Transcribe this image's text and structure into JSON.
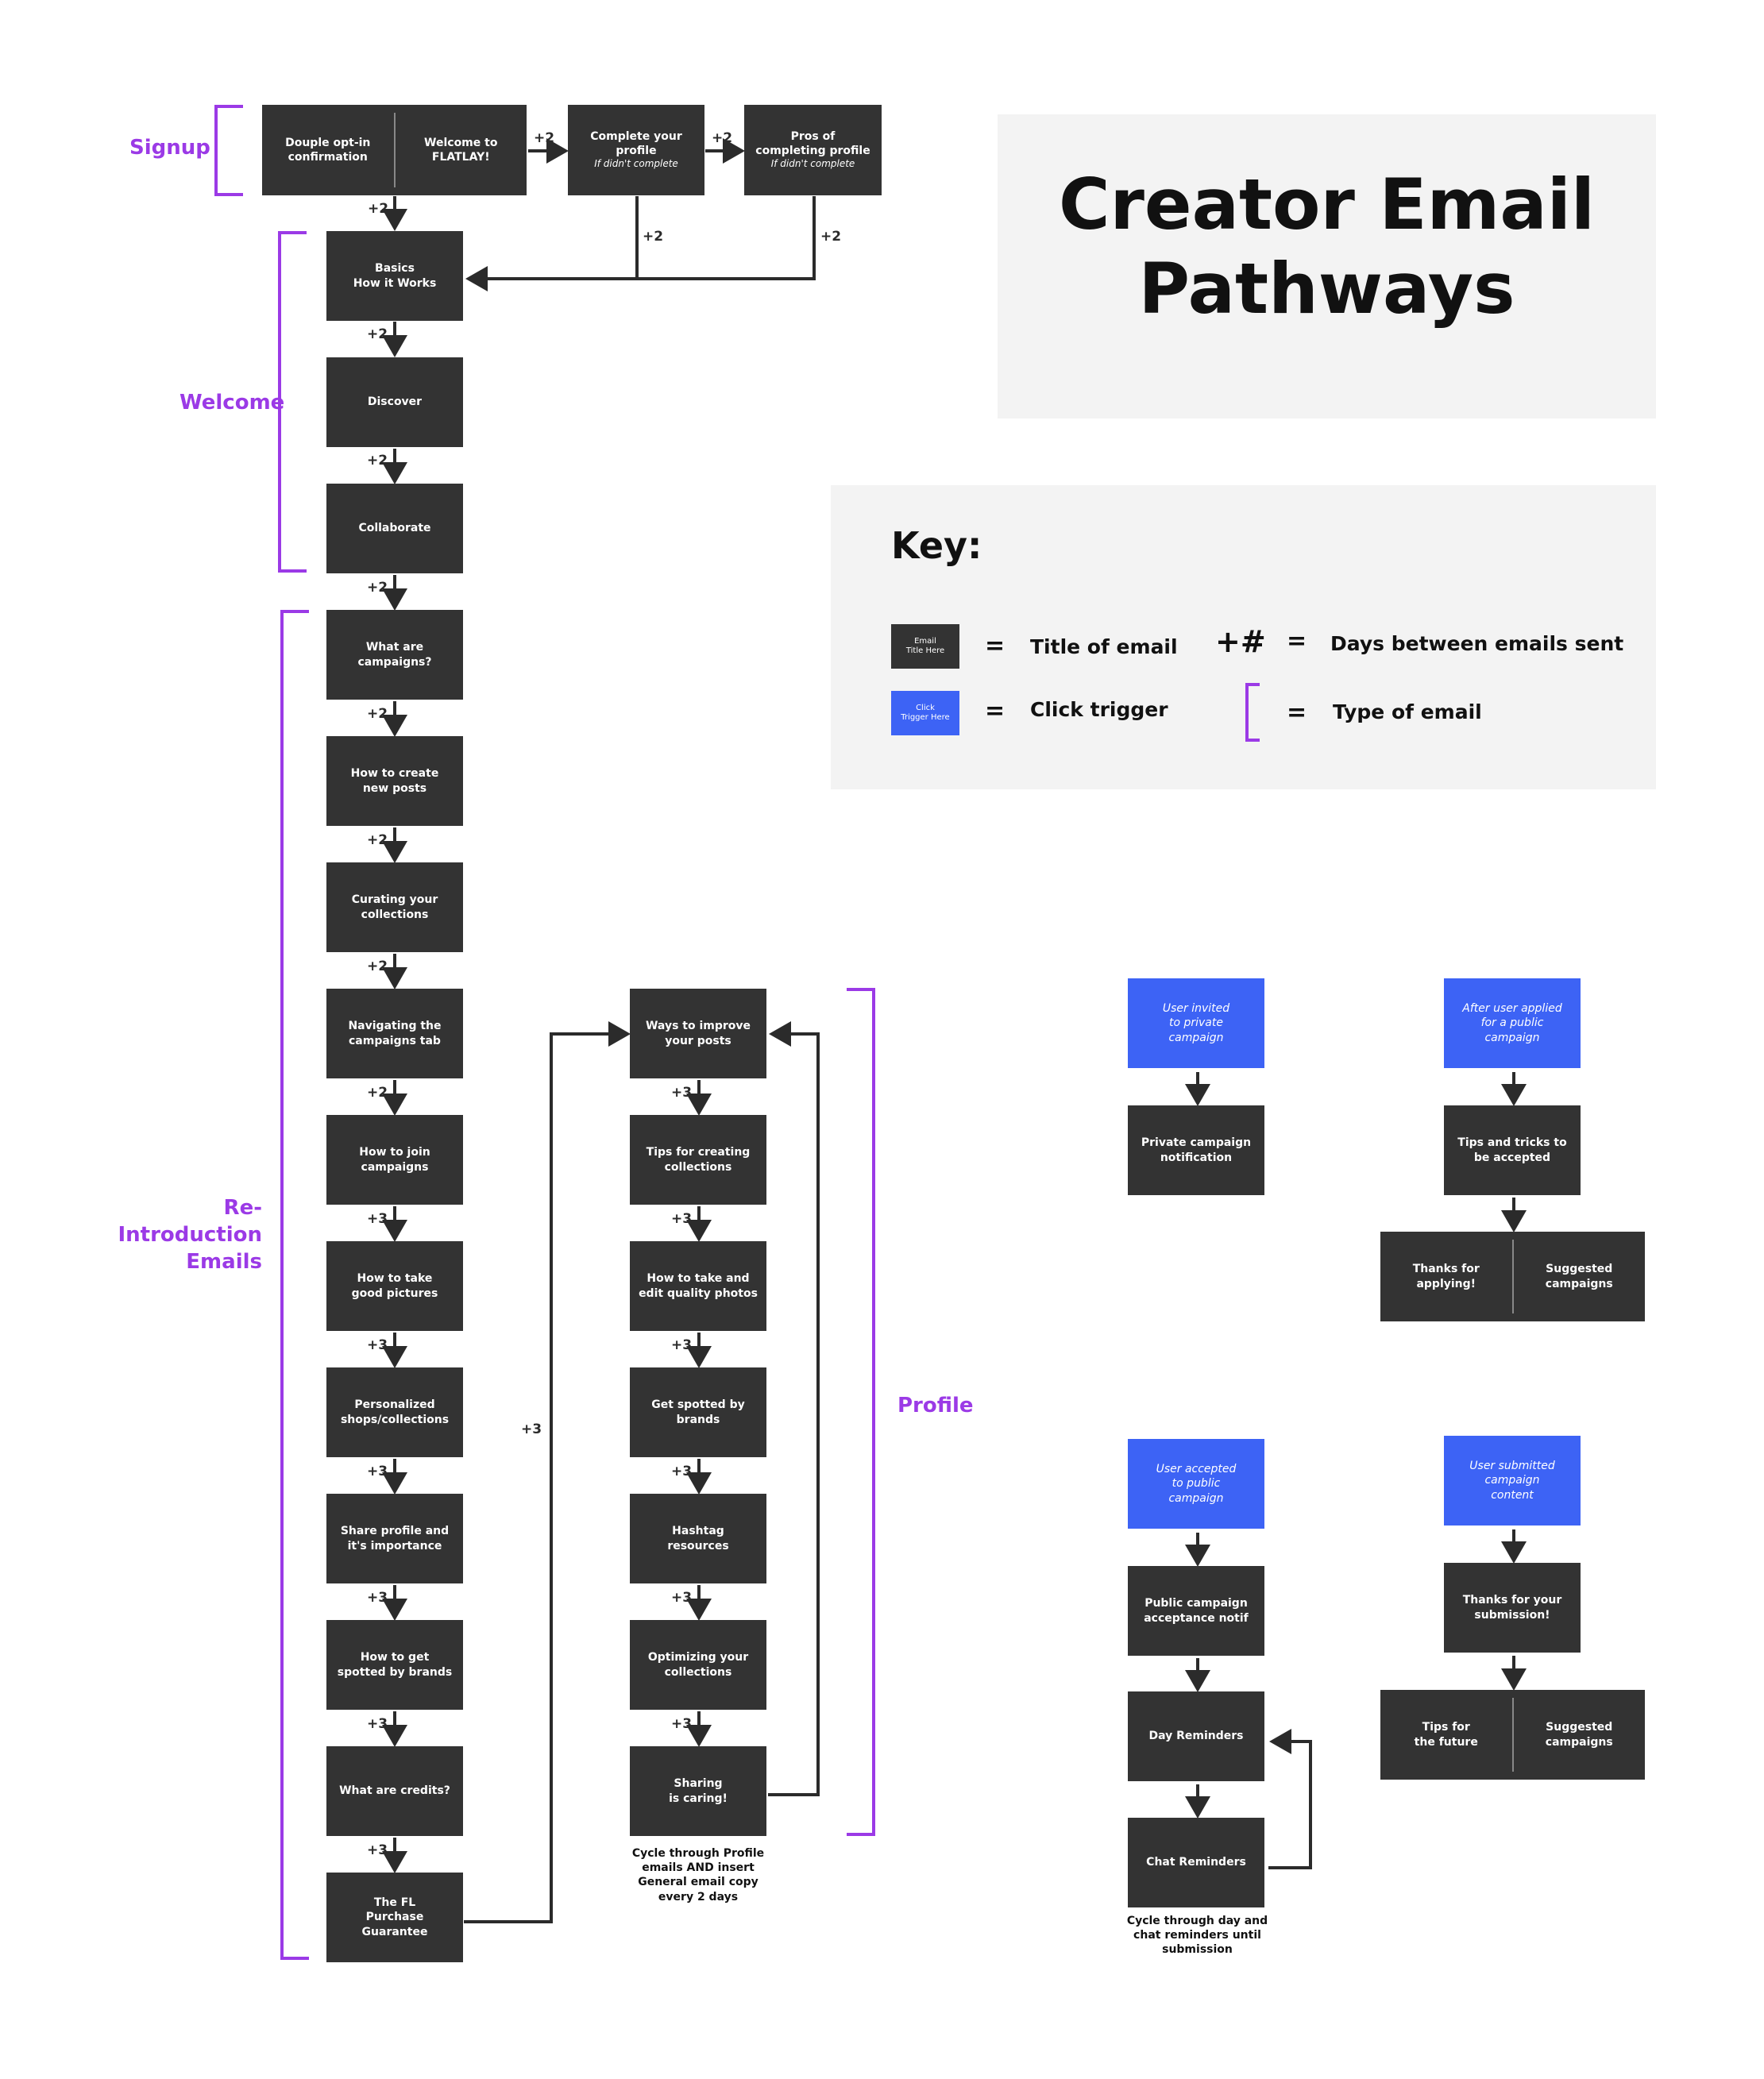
{
  "title": "Creator Email\nPathways",
  "key": {
    "heading": "Key:",
    "swatch_email": "Email\nTitle Here",
    "swatch_click": "Click\nTrigger Here",
    "eq": "=",
    "title_of_email": "Title of email",
    "click_trigger": "Click trigger",
    "days_symbol": "+#",
    "days_between": "Days between emails sent",
    "type_of_email": "Type of email"
  },
  "sections": {
    "signup": "Signup",
    "welcome": "Welcome",
    "reintro": "Re-Introduction\nEmails",
    "profile": "Profile"
  },
  "signup": {
    "double_optin": "Douple opt-in\nconfirmation",
    "welcome": "Welcome to\nFLATLAY!",
    "complete_profile": "Complete your\nprofile",
    "complete_profile_sub": "If didn't complete",
    "pros_profile": "Pros of\ncompleting profile",
    "pros_profile_sub": "If didn't complete"
  },
  "welcome": {
    "basics": "Basics\nHow it Works",
    "discover": "Discover",
    "collaborate": "Collaborate"
  },
  "reintro": [
    "What are\ncampaigns?",
    "How to create\nnew posts",
    "Curating your\ncollections",
    "Navigating the\ncampaigns tab",
    "How to join\ncampaigns",
    "How to take\ngood pictures",
    "Personalized\nshops/collections",
    "Share profile and\nit's importance",
    "How to get\nspotted by brands",
    "What are credits?",
    "The FL\nPurchase\nGuarantee"
  ],
  "profile": [
    "Ways to improve\nyour posts",
    "Tips for creating\ncollections",
    "How to take and\nedit quality photos",
    "Get spotted by\nbrands",
    "Hashtag\nresources",
    "Optimizing your\ncollections",
    "Sharing\nis caring!"
  ],
  "profile_note": "Cycle through Profile\nemails AND insert\nGeneral email copy\nevery 2 days",
  "gaps": {
    "plus2": "+2",
    "plus3": "+3"
  },
  "campaigns": {
    "private_trigger": "User invited\nto private\ncampaign",
    "private_notif": "Private campaign\nnotification",
    "applied_trigger": "After user applied\nfor a public\ncampaign",
    "tips_accepted": "Tips and tricks to\nbe accepted",
    "thanks_applying": "Thanks for\napplying!",
    "suggested_1": "Suggested\ncampaigns",
    "accepted_trigger": "User accepted\nto public\ncampaign",
    "public_accept": "Public campaign\nacceptance notif",
    "day_reminders": "Day Reminders",
    "chat_reminders": "Chat Reminders",
    "reminder_note": "Cycle through day and\nchat reminders until\nsubmission",
    "submitted_trigger": "User submitted\ncampaign\ncontent",
    "thanks_submission": "Thanks for your\nsubmission!",
    "tips_future": "Tips for\nthe future",
    "suggested_2": "Suggested\ncampaigns"
  },
  "colors": {
    "box": "#333333",
    "trigger": "#3d63f5",
    "bracket": "#9b3ae6",
    "panel": "#f3f3f3"
  }
}
